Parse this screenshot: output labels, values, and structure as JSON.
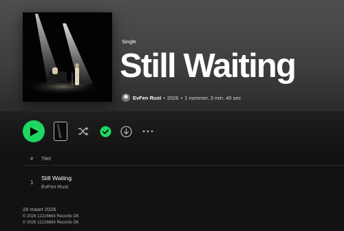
{
  "album": {
    "kind": "Single",
    "title": "Still Waiting",
    "artist": "EvFen Rust",
    "year": "2026",
    "summary": "1 nummer, 3 min. 40 sec"
  },
  "columns": {
    "number": "#",
    "title": "Titel"
  },
  "tracks": [
    {
      "number": "1",
      "title": "Still Waiting",
      "artist": "EvFen Rust"
    }
  ],
  "footer": {
    "release_date": "28 maart 2026",
    "copyright": "© 2026 12216664 Records DK",
    "phonographic": "℗ 2026 12216664 Records DK"
  },
  "icons": {
    "play": "play-icon",
    "shuffle": "shuffle-icon",
    "saved": "check-circle-icon",
    "download": "download-icon",
    "more": "more-icon"
  },
  "colors": {
    "accent": "#1ed760",
    "background": "#121212",
    "hero": "#4f4f4f"
  }
}
